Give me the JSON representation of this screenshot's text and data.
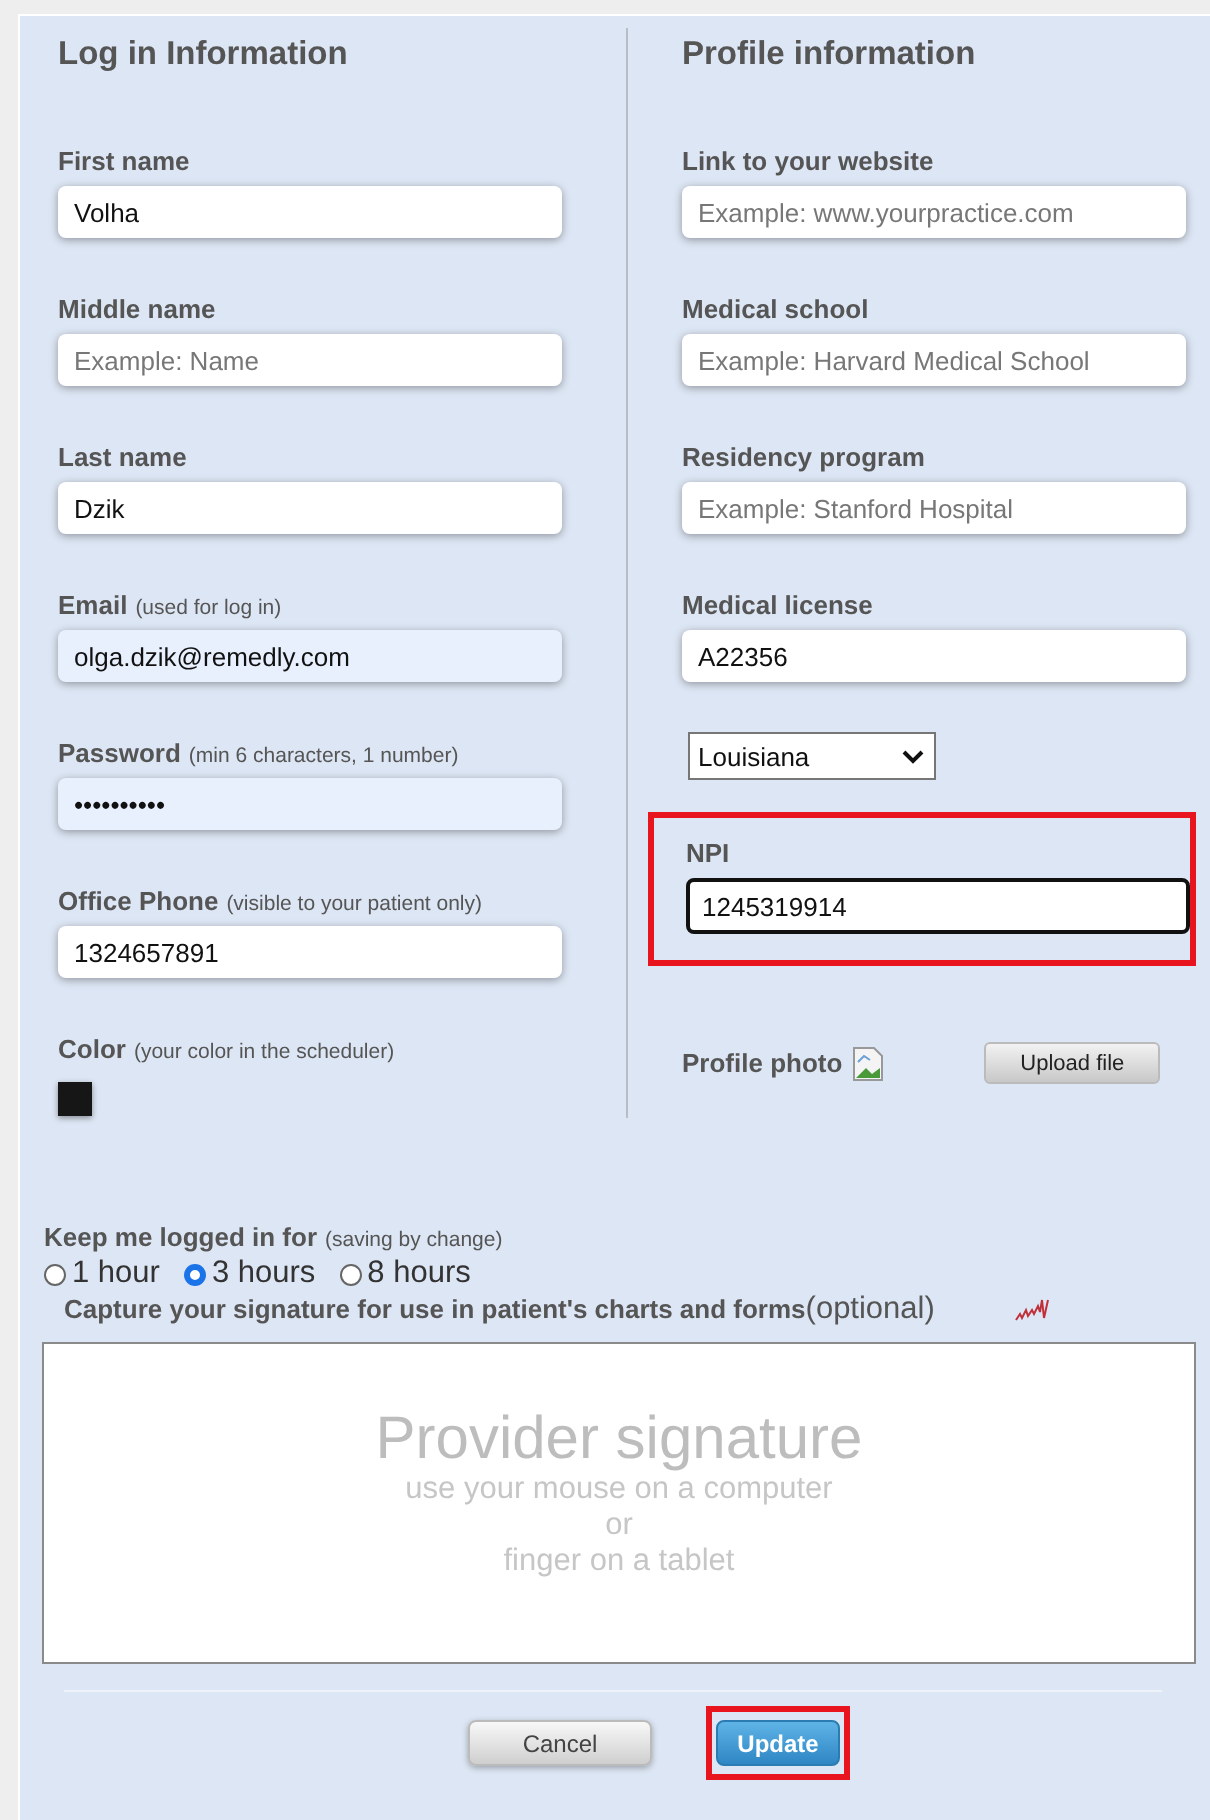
{
  "login_section": {
    "title": "Log in Information",
    "fields": [
      {
        "label": "First name",
        "value": "Volha",
        "autofill": false
      },
      {
        "label": "Middle name",
        "placeholder": "Example: Name",
        "autofill": false
      },
      {
        "label": "Last name",
        "value": "Dzik",
        "autofill": false
      },
      {
        "label": "Email",
        "hint": "(used for log in)",
        "value": "olga.dzik@remedly.com",
        "autofill": true
      },
      {
        "label": "Password",
        "hint": "(min 6 characters, 1 number)",
        "value": "••••••••••",
        "autofill": true
      },
      {
        "label": "Office Phone",
        "hint": "(visible to your patient only)",
        "value": "1324657891",
        "autofill": false
      }
    ],
    "color": {
      "label": "Color",
      "hint": "(your color in the scheduler)",
      "color": "#161616"
    }
  },
  "profile_section": {
    "title": "Profile information",
    "fields": [
      {
        "label": "Link to your website",
        "placeholder": "Example: www.yourpractice.com"
      },
      {
        "label": "Medical school",
        "placeholder": "Example: Harvard Medical School"
      },
      {
        "label": "Residency program",
        "placeholder": "Example: Stanford Hospital"
      },
      {
        "label": "Medical license",
        "value": "A22356"
      }
    ],
    "state_select": {
      "value": "Louisiana"
    },
    "npi": {
      "label": "NPI",
      "value": "1245319914",
      "focused": true,
      "highlighted": true
    },
    "profile_photo": {
      "label": "Profile photo",
      "button": "Upload file"
    }
  },
  "session": {
    "label": "Keep me logged in for",
    "hint": "(saving by change)",
    "options": [
      {
        "label": "1 hour",
        "selected": false
      },
      {
        "label": "3 hours",
        "selected": true
      },
      {
        "label": "8 hours",
        "selected": false
      }
    ]
  },
  "signature": {
    "caption": "Capture your signature for use in patient's charts and forms",
    "caption_note": "(optional)",
    "title": "Provider signature",
    "lines": [
      "use your mouse on a computer",
      "or",
      "finger on a tablet"
    ]
  },
  "buttons": [
    {
      "label": "Cancel",
      "kind": "secondary",
      "highlighted": false
    },
    {
      "label": "Update",
      "kind": "primary",
      "highlighted": true
    }
  ]
}
